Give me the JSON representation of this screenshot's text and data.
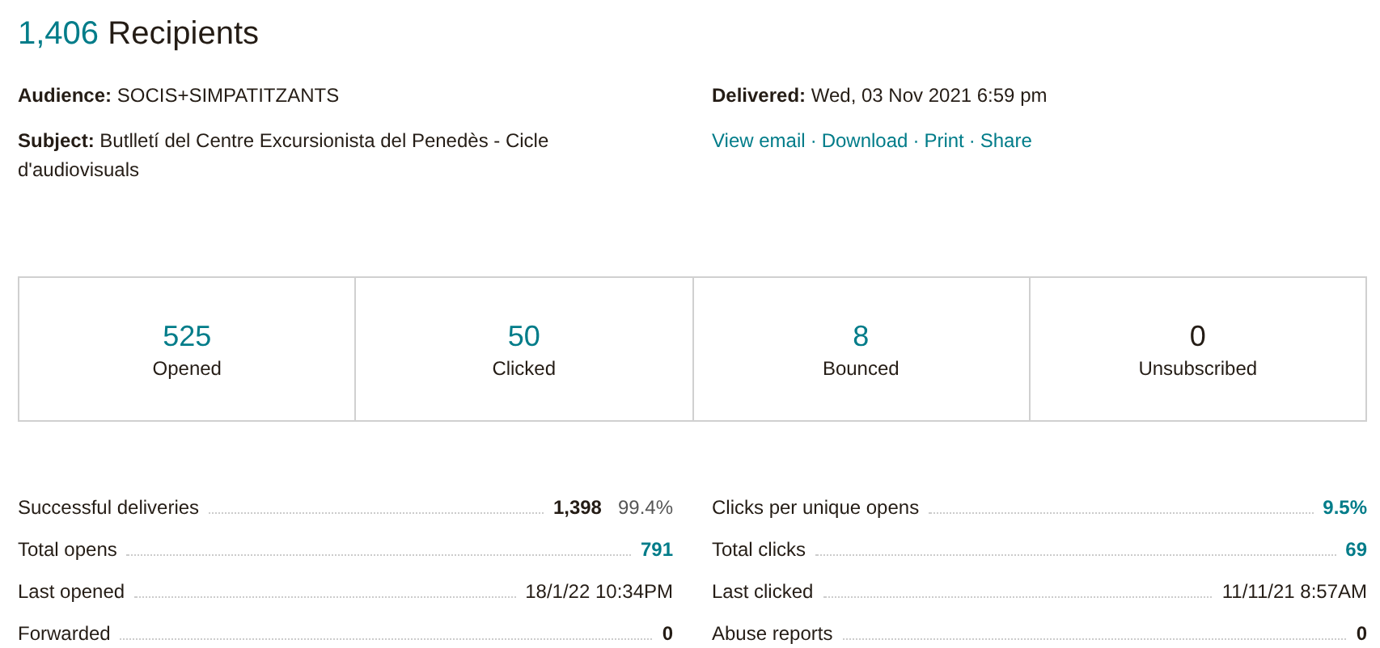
{
  "header": {
    "count": "1,406",
    "title": "Recipients"
  },
  "details_left": [
    {
      "label": "Audience:",
      "value": "SOCIS+SIMPATITZANTS"
    },
    {
      "label": "Subject:",
      "value": "Butlletí del Centre Excursionista del Penedès - Cicle d'audiovisuals"
    }
  ],
  "details_right": [
    {
      "label": "Delivered:",
      "value": "Wed, 03 Nov 2021 6:59 pm"
    }
  ],
  "actions": [
    "View email",
    "Download",
    "Print",
    "Share"
  ],
  "action_separator": "·",
  "stats": [
    {
      "value": "525",
      "label": "Opened",
      "kind": "link"
    },
    {
      "value": "50",
      "label": "Clicked",
      "kind": "link"
    },
    {
      "value": "8",
      "label": "Bounced",
      "kind": "link"
    },
    {
      "value": "0",
      "label": "Unsubscribed",
      "kind": "plain"
    }
  ],
  "metrics_left": [
    {
      "label": "Successful deliveries",
      "value": "1,398",
      "extra": "99.4%",
      "kind": "bold"
    },
    {
      "label": "Total opens",
      "value": "791",
      "kind": "link"
    },
    {
      "label": "Last opened",
      "value": "18/1/22 10:34PM",
      "kind": "plain"
    },
    {
      "label": "Forwarded",
      "value": "0",
      "kind": "bold"
    }
  ],
  "metrics_right": [
    {
      "label": "Clicks per unique opens",
      "value": "9.5%",
      "kind": "link"
    },
    {
      "label": "Total clicks",
      "value": "69",
      "kind": "link"
    },
    {
      "label": "Last clicked",
      "value": "11/11/21 8:57AM",
      "kind": "plain"
    },
    {
      "label": "Abuse reports",
      "value": "0",
      "kind": "bold"
    }
  ]
}
